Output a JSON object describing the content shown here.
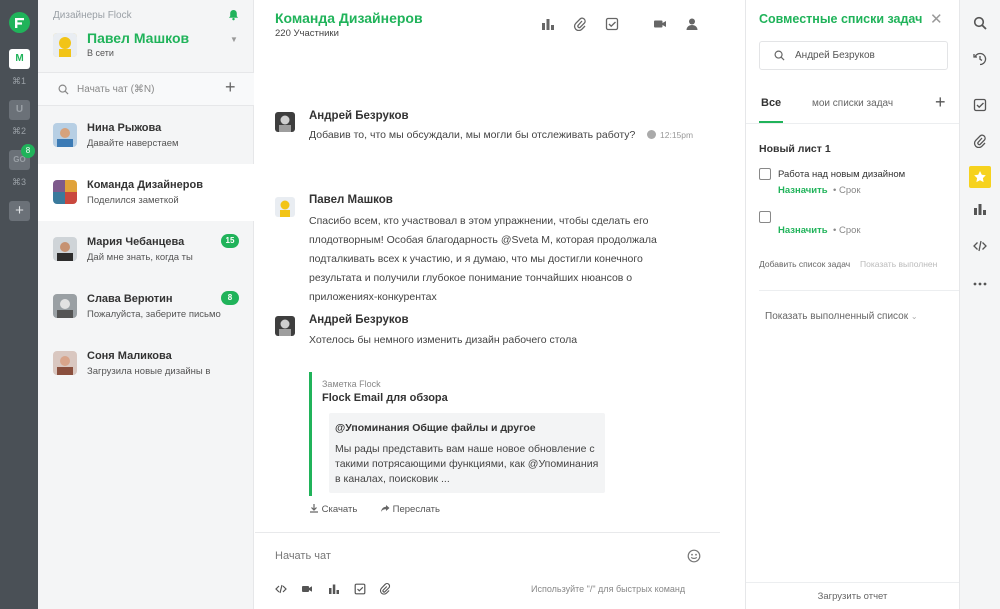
{
  "workspaces": {
    "active_letter": "M",
    "shortcuts": [
      "⌘1",
      "⌘2",
      "⌘3"
    ],
    "second_letter": "U",
    "third_letter": "GO",
    "notification_count": "8",
    "add_label": "+"
  },
  "sidebar": {
    "team_name": "Дизайнеры Flock",
    "user_name": "Павел Машков",
    "user_status": "В сети",
    "search_placeholder": "Начать чат (⌘N)",
    "chats": [
      {
        "name": "Нина Рыжова",
        "preview": "Давайте наверстаем",
        "badge": ""
      },
      {
        "name": "Команда Дизайнеров",
        "preview": "Поделился заметкой",
        "badge": ""
      },
      {
        "name": "Мария Чебанцева",
        "preview": "Дай мне знать, когда ты",
        "badge": "15"
      },
      {
        "name": "Слава Верютин",
        "preview": "Пожалуйста, заберите письмо",
        "badge": "8"
      },
      {
        "name": "Соня Маликова",
        "preview": "Загрузила новые дизайны в",
        "badge": ""
      }
    ]
  },
  "channel": {
    "title": "Команда Дизайнеров",
    "members": "220 Участники"
  },
  "messages": [
    {
      "author": "Андрей Безруков",
      "text": "Добавив то, что мы обсуждали, мы могли бы отслеживать работу?",
      "time": "12:15pm"
    },
    {
      "author": "Павел Машков",
      "text": "Спасибо всем, кто участвовал в этом упражнении, чтобы сделать его плодотворным! Особая благодарность @Sveta M, которая продолжала подталкивать всех к участию, и я думаю, что мы достигли конечного результата и получили глубокое понимание тончайших нюансов о приложениях-конкурентах"
    },
    {
      "author": "Андрей Безруков",
      "text": "Хотелось бы немного изменить дизайн рабочего стола"
    }
  ],
  "note": {
    "label": "Заметка Flock",
    "title": "Flock Email для обзора",
    "card_title": "@Упоминания Общие файлы и другое",
    "card_body": "Мы рады представить вам наше новое обновление с такими потрясающими функциями, как @Упоминания в каналах, поисковик ...",
    "download": "Скачать",
    "forward": "Переслать"
  },
  "composer": {
    "placeholder": "Начать чат",
    "hint": "Используйте \"/\" для быстрых команд"
  },
  "tasks": {
    "title": "Совместные списки задач",
    "search_value": "Андрей Безруков",
    "tab_all": "Все",
    "tab_mine": "мои списки задач",
    "list_name": "Новый лист 1",
    "items": [
      {
        "text": "Работа над новым дизайном",
        "assign": "Назначить",
        "due": "Срок"
      },
      {
        "text": "",
        "assign": "Назначить",
        "due": "Срок"
      }
    ],
    "add_task": "Добавить список задач",
    "show_done": "Показать выполнен",
    "show_done_list": "Показать выполненный список",
    "report": "Загрузить отчет"
  },
  "colors": {
    "accent": "#20b35a",
    "rail": "#4a5056",
    "star": "#f6d21e"
  }
}
